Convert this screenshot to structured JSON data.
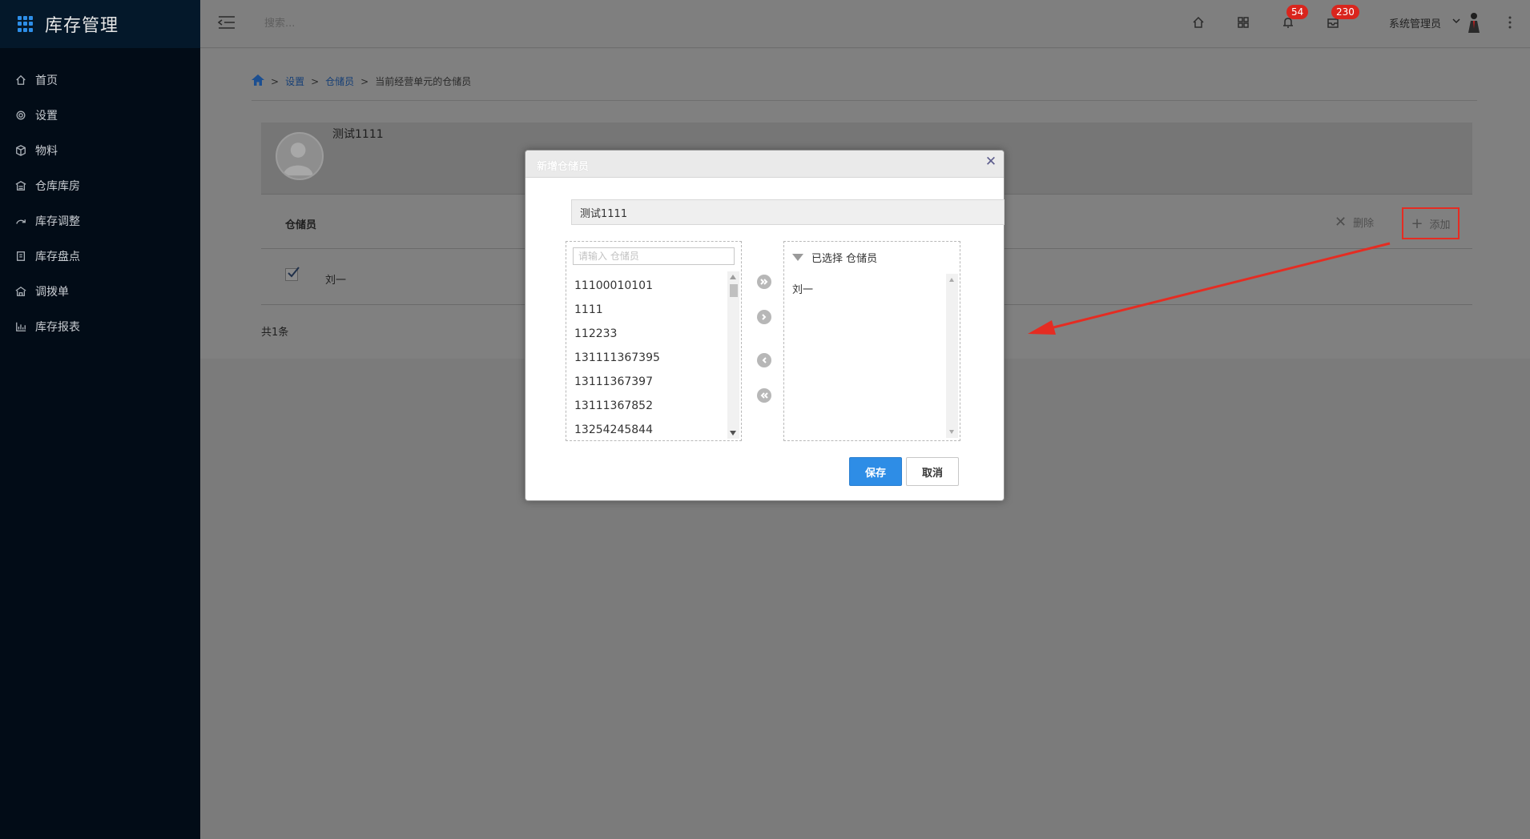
{
  "app": {
    "title": "库存管理"
  },
  "sidebar": {
    "items": [
      {
        "label": "首页",
        "icon": "home-icon"
      },
      {
        "label": "设置",
        "icon": "gear-icon"
      },
      {
        "label": "物料",
        "icon": "cube-icon"
      },
      {
        "label": "仓库库房",
        "icon": "warehouse-icon"
      },
      {
        "label": "库存调整",
        "icon": "adjust-icon"
      },
      {
        "label": "库存盘点",
        "icon": "inventory-icon"
      },
      {
        "label": "调拨单",
        "icon": "transfer-icon"
      },
      {
        "label": "库存报表",
        "icon": "bar-chart-icon"
      }
    ]
  },
  "topbar": {
    "search_placeholder": "搜索...",
    "notifications_count": "54",
    "messages_count": "230",
    "user_name": "系统管理员"
  },
  "breadcrumb": {
    "items": [
      "设置",
      "仓储员"
    ],
    "current": "当前经营单元的仓储员"
  },
  "panel": {
    "unit_name": "测试1111",
    "column_title": "仓储员",
    "delete_label": "删除",
    "add_label": "添加",
    "rows": [
      {
        "name": "刘一",
        "checked": true
      }
    ],
    "total_text": "共1条"
  },
  "modal": {
    "title": "新增仓储员",
    "unit_name": "测试1111",
    "filter_placeholder": "请输入 仓储员",
    "available": [
      "11100010101",
      "1111",
      "112233",
      "131111367395",
      "13111367397",
      "13111367852",
      "13254245844"
    ],
    "selected_header": "已选择 仓储员",
    "selected": [
      "刘一"
    ],
    "save_label": "保存",
    "cancel_label": "取消"
  },
  "colors": {
    "sidebar_bg": "#020c17",
    "accent_blue": "#2e8de6",
    "badge_red": "#d9251d",
    "highlight_red": "#e52c22"
  }
}
